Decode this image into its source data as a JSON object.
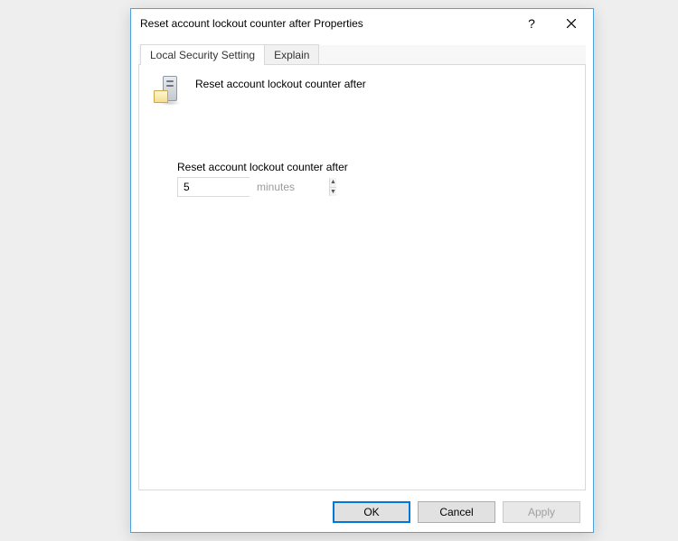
{
  "window": {
    "title": "Reset account lockout counter after Properties"
  },
  "tabs": [
    {
      "label": "Local Security Setting",
      "active": true
    },
    {
      "label": "Explain",
      "active": false
    }
  ],
  "policy": {
    "heading": "Reset account lockout counter after",
    "field_label": "Reset account lockout counter after",
    "value": "5",
    "unit": "minutes"
  },
  "buttons": {
    "ok": "OK",
    "cancel": "Cancel",
    "apply": "Apply"
  }
}
